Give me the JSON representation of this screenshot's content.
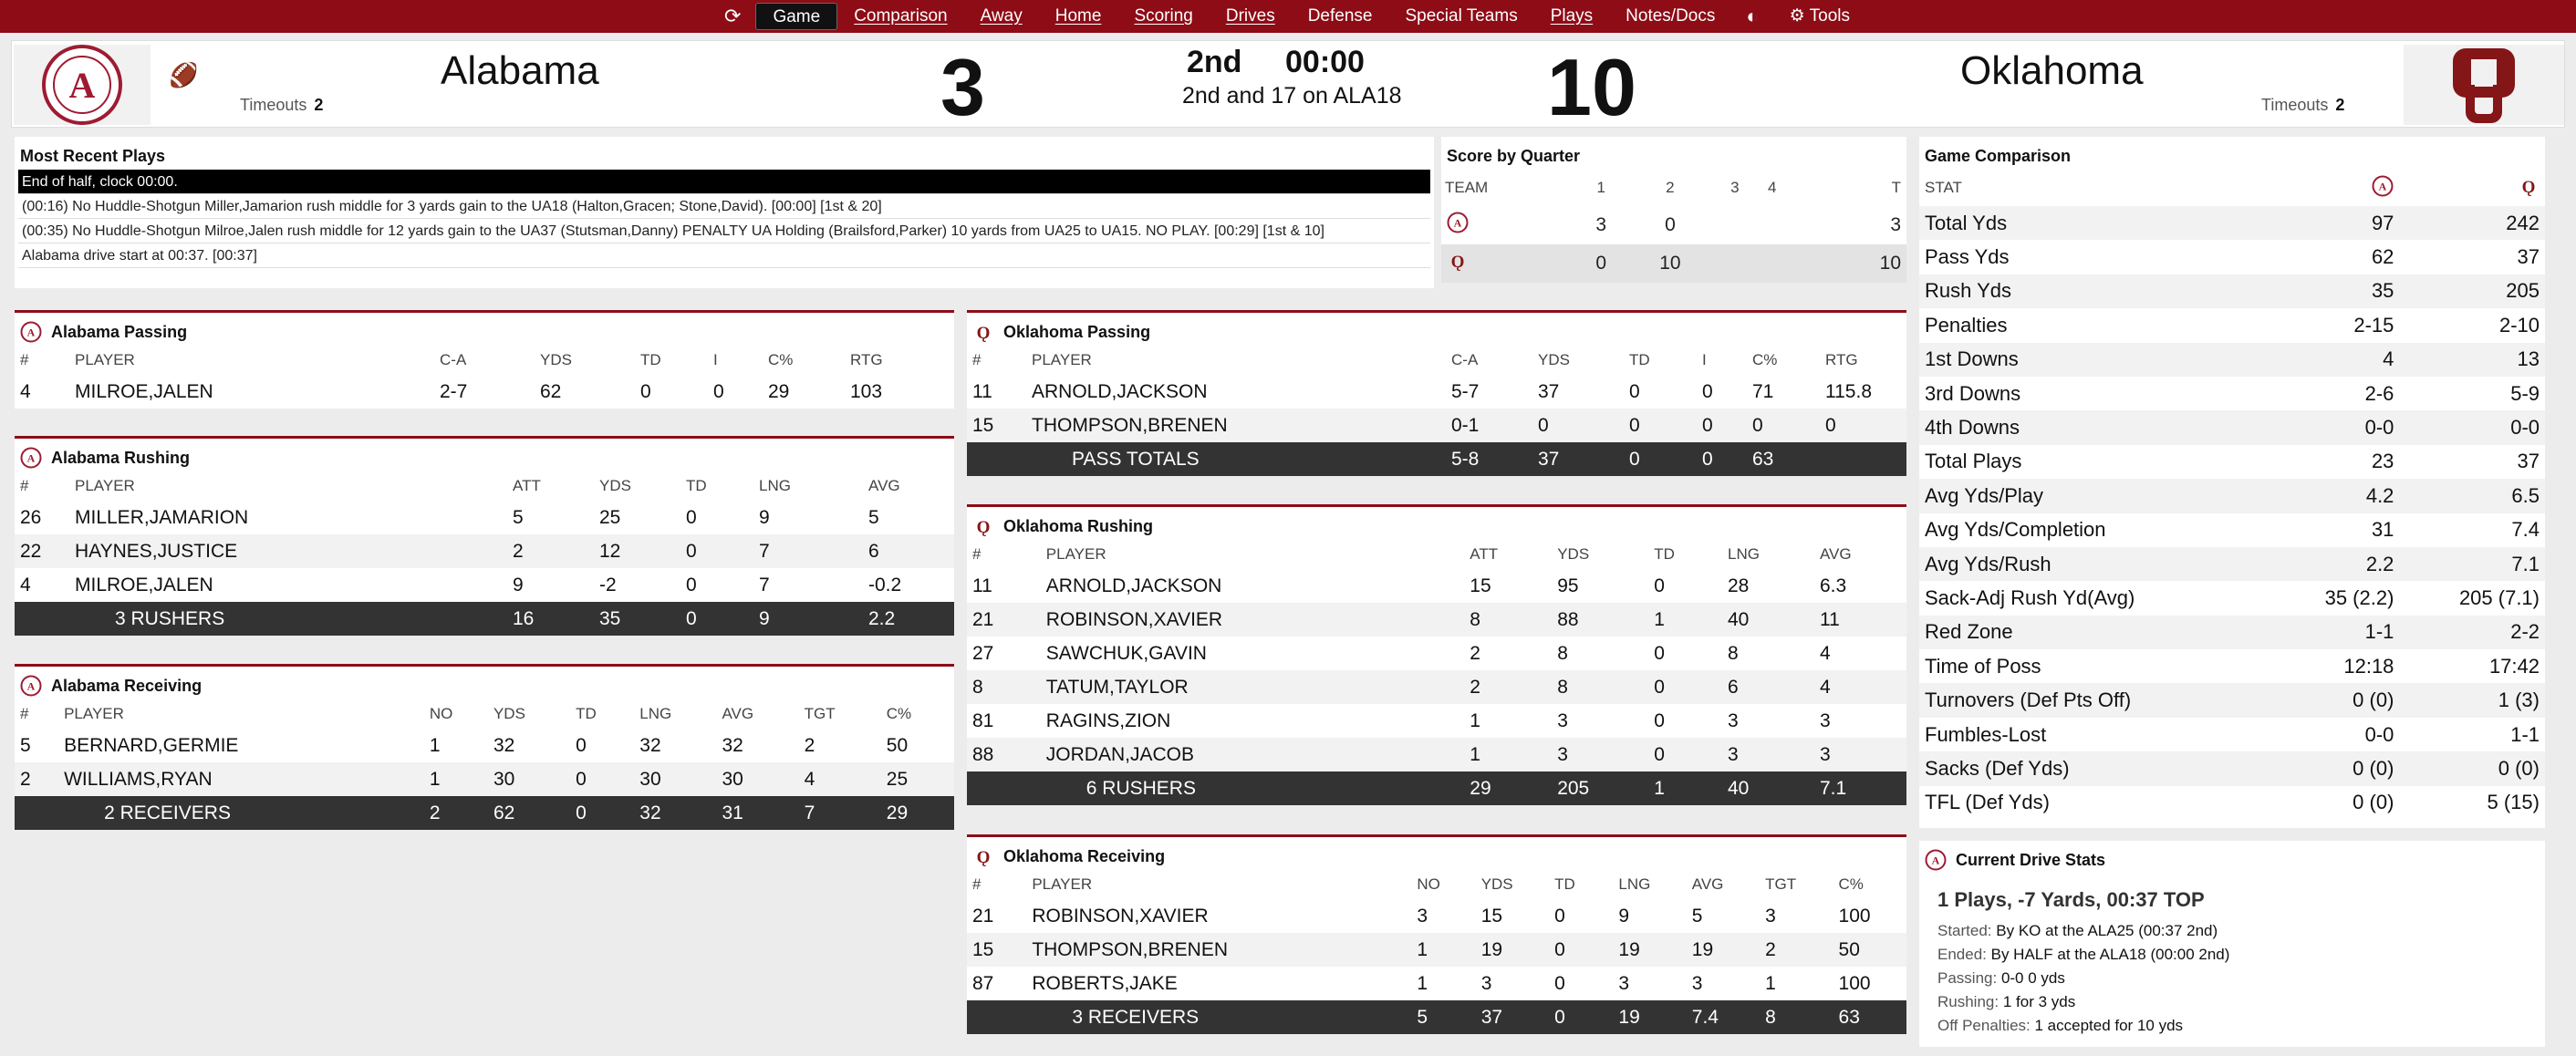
{
  "nav": {
    "items": [
      "Game",
      "Comparison",
      "Away",
      "Home",
      "Scoring",
      "Drives",
      "Defense",
      "Special Teams",
      "Plays",
      "Notes/Docs"
    ],
    "tools_label": "Tools"
  },
  "scoreboard": {
    "away": {
      "name": "Alabama",
      "score": "3",
      "timeouts_label": "Timeouts",
      "timeouts": "2",
      "logo_text": "ALABAMA"
    },
    "home": {
      "name": "Oklahoma",
      "score": "10",
      "timeouts_label": "Timeouts",
      "timeouts": "2"
    },
    "period": "2nd",
    "clock": "00:00",
    "down": "2nd and 17 on ALA18"
  },
  "recent_plays": {
    "title": "Most Recent Plays",
    "rows": [
      "End of half, clock 00:00.",
      "(00:16) No Huddle-Shotgun Miller,Jamarion rush middle for 3 yards gain to the UA18 (Halton,Gracen; Stone,David). [00:00] [1st & 20]",
      "(00:35) No Huddle-Shotgun Milroe,Jalen rush middle for 12 yards gain to the UA37 (Stutsman,Danny) PENALTY UA Holding (Brailsford,Parker) 10 yards from UA25 to UA15. NO PLAY. [00:29] [1st & 10]",
      "Alabama drive start at 00:37. [00:37]"
    ]
  },
  "score_by_quarter": {
    "title": "Score by Quarter",
    "headers": [
      "TEAM",
      "1",
      "2",
      "3",
      "4",
      "T"
    ],
    "rows": [
      [
        "",
        "3",
        "0",
        "",
        "",
        "3"
      ],
      [
        "",
        "0",
        "10",
        "",
        "",
        "10"
      ]
    ]
  },
  "game_comparison": {
    "title": "Game Comparison",
    "stat_header": "STAT",
    "rows": [
      [
        "Total Yds",
        "97",
        "242"
      ],
      [
        "Pass Yds",
        "62",
        "37"
      ],
      [
        "Rush Yds",
        "35",
        "205"
      ],
      [
        "Penalties",
        "2-15",
        "2-10"
      ],
      [
        "1st Downs",
        "4",
        "13"
      ],
      [
        "3rd Downs",
        "2-6",
        "5-9"
      ],
      [
        "4th Downs",
        "0-0",
        "0-0"
      ],
      [
        "Total Plays",
        "23",
        "37"
      ],
      [
        "Avg Yds/Play",
        "4.2",
        "6.5"
      ],
      [
        "Avg Yds/Completion",
        "31",
        "7.4"
      ],
      [
        "Avg Yds/Rush",
        "2.2",
        "7.1"
      ],
      [
        "Sack-Adj Rush Yd(Avg)",
        "35 (2.2)",
        "205 (7.1)"
      ],
      [
        "Red Zone",
        "1-1",
        "2-2"
      ],
      [
        "Time of Poss",
        "12:18",
        "17:42"
      ],
      [
        "Turnovers (Def Pts Off)",
        "0 (0)",
        "1 (3)"
      ],
      [
        "Fumbles-Lost",
        "0-0",
        "1-1"
      ],
      [
        "Sacks (Def Yds)",
        "0 (0)",
        "0 (0)"
      ],
      [
        "TFL (Def Yds)",
        "0 (0)",
        "5 (15)"
      ]
    ]
  },
  "bama_passing": {
    "title": "Alabama Passing",
    "headers": [
      "#",
      "PLAYER",
      "C-A",
      "YDS",
      "TD",
      "I",
      "C%",
      "RTG"
    ],
    "rows": [
      [
        "4",
        "MILROE,JALEN",
        "2-7",
        "62",
        "0",
        "0",
        "29",
        "103"
      ]
    ]
  },
  "bama_rushing": {
    "title": "Alabama Rushing",
    "headers": [
      "#",
      "PLAYER",
      "ATT",
      "YDS",
      "TD",
      "LNG",
      "AVG"
    ],
    "rows": [
      [
        "26",
        "MILLER,JAMARION",
        "5",
        "25",
        "0",
        "9",
        "5"
      ],
      [
        "22",
        "HAYNES,JUSTICE",
        "2",
        "12",
        "0",
        "7",
        "6"
      ],
      [
        "4",
        "MILROE,JALEN",
        "9",
        "-2",
        "0",
        "7",
        "-0.2"
      ]
    ],
    "total": [
      "",
      "3 RUSHERS",
      "16",
      "35",
      "0",
      "9",
      "2.2"
    ]
  },
  "bama_receiving": {
    "title": "Alabama Receiving",
    "headers": [
      "#",
      "PLAYER",
      "NO",
      "YDS",
      "TD",
      "LNG",
      "AVG",
      "TGT",
      "C%"
    ],
    "rows": [
      [
        "5",
        "BERNARD,GERMIE",
        "1",
        "32",
        "0",
        "32",
        "32",
        "2",
        "50"
      ],
      [
        "2",
        "WILLIAMS,RYAN",
        "1",
        "30",
        "0",
        "30",
        "30",
        "4",
        "25"
      ]
    ],
    "total": [
      "",
      "2 RECEIVERS",
      "2",
      "62",
      "0",
      "32",
      "31",
      "7",
      "29"
    ]
  },
  "ou_passing": {
    "title": "Oklahoma Passing",
    "headers": [
      "#",
      "PLAYER",
      "C-A",
      "YDS",
      "TD",
      "I",
      "C%",
      "RTG"
    ],
    "rows": [
      [
        "11",
        "ARNOLD,JACKSON",
        "5-7",
        "37",
        "0",
        "0",
        "71",
        "115.8"
      ],
      [
        "15",
        "THOMPSON,BRENEN",
        "0-1",
        "0",
        "0",
        "0",
        "0",
        "0"
      ]
    ],
    "total": [
      "",
      "PASS TOTALS",
      "5-8",
      "37",
      "0",
      "0",
      "63",
      ""
    ]
  },
  "ou_rushing": {
    "title": "Oklahoma Rushing",
    "headers": [
      "#",
      "PLAYER",
      "ATT",
      "YDS",
      "TD",
      "LNG",
      "AVG"
    ],
    "rows": [
      [
        "11",
        "ARNOLD,JACKSON",
        "15",
        "95",
        "0",
        "28",
        "6.3"
      ],
      [
        "21",
        "ROBINSON,XAVIER",
        "8",
        "88",
        "1",
        "40",
        "11"
      ],
      [
        "27",
        "SAWCHUK,GAVIN",
        "2",
        "8",
        "0",
        "8",
        "4"
      ],
      [
        "8",
        "TATUM,TAYLOR",
        "2",
        "8",
        "0",
        "6",
        "4"
      ],
      [
        "81",
        "RAGINS,ZION",
        "1",
        "3",
        "0",
        "3",
        "3"
      ],
      [
        "88",
        "JORDAN,JACOB",
        "1",
        "3",
        "0",
        "3",
        "3"
      ]
    ],
    "total": [
      "",
      "6 RUSHERS",
      "29",
      "205",
      "1",
      "40",
      "7.1"
    ]
  },
  "ou_receiving": {
    "title": "Oklahoma Receiving",
    "headers": [
      "#",
      "PLAYER",
      "NO",
      "YDS",
      "TD",
      "LNG",
      "AVG",
      "TGT",
      "C%"
    ],
    "rows": [
      [
        "21",
        "ROBINSON,XAVIER",
        "3",
        "15",
        "0",
        "9",
        "5",
        "3",
        "100"
      ],
      [
        "15",
        "THOMPSON,BRENEN",
        "1",
        "19",
        "0",
        "19",
        "19",
        "2",
        "50"
      ],
      [
        "87",
        "ROBERTS,JAKE",
        "1",
        "3",
        "0",
        "3",
        "3",
        "1",
        "100"
      ]
    ],
    "total": [
      "",
      "3 RECEIVERS",
      "5",
      "37",
      "0",
      "19",
      "7.4",
      "8",
      "63"
    ]
  },
  "current_drive": {
    "title": "Current Drive Stats",
    "headline": "1 Plays, -7 Yards, 00:37 TOP",
    "lines": [
      {
        "k": "Started:",
        "v": "By KO at the ALA25 (00:37 2nd)"
      },
      {
        "k": "Ended:",
        "v": "By HALF at the ALA18 (00:00 2nd)"
      },
      {
        "k": "Passing:",
        "v": "0-0 0 yds"
      },
      {
        "k": "Rushing:",
        "v": "1 for 3 yds"
      },
      {
        "k": "Off Penalties:",
        "v": "1 accepted for 10 yds"
      }
    ]
  },
  "colors": {
    "crimson": "#8d0c16",
    "bama": "#9e1b32",
    "ou": "#841617",
    "total_row": "#333333"
  }
}
